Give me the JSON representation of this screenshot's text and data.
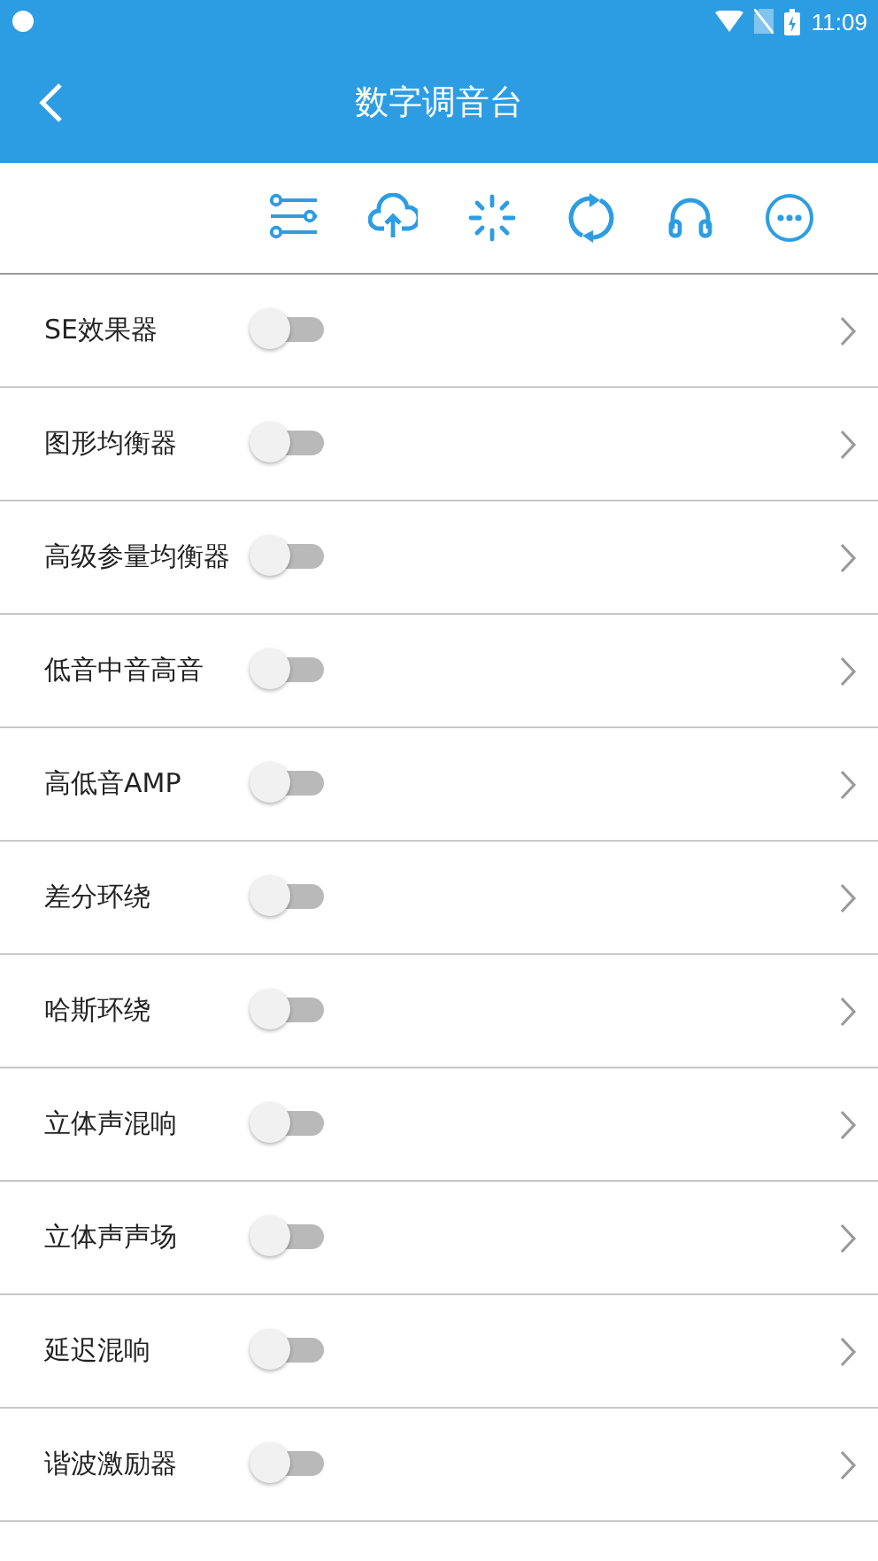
{
  "status_bar": {
    "time": "11:09"
  },
  "app_bar": {
    "title": "数字调音台"
  },
  "effects": [
    {
      "label": "SE效果器",
      "on": false
    },
    {
      "label": "图形均衡器",
      "on": false
    },
    {
      "label": "高级参量均衡器",
      "on": false
    },
    {
      "label": "低音中音高音",
      "on": false
    },
    {
      "label": "高低音AMP",
      "on": false
    },
    {
      "label": "差分环绕",
      "on": false
    },
    {
      "label": "哈斯环绕",
      "on": false
    },
    {
      "label": "立体声混响",
      "on": false
    },
    {
      "label": "立体声声场",
      "on": false
    },
    {
      "label": "延迟混响",
      "on": false
    },
    {
      "label": "谐波激励器",
      "on": false
    }
  ]
}
